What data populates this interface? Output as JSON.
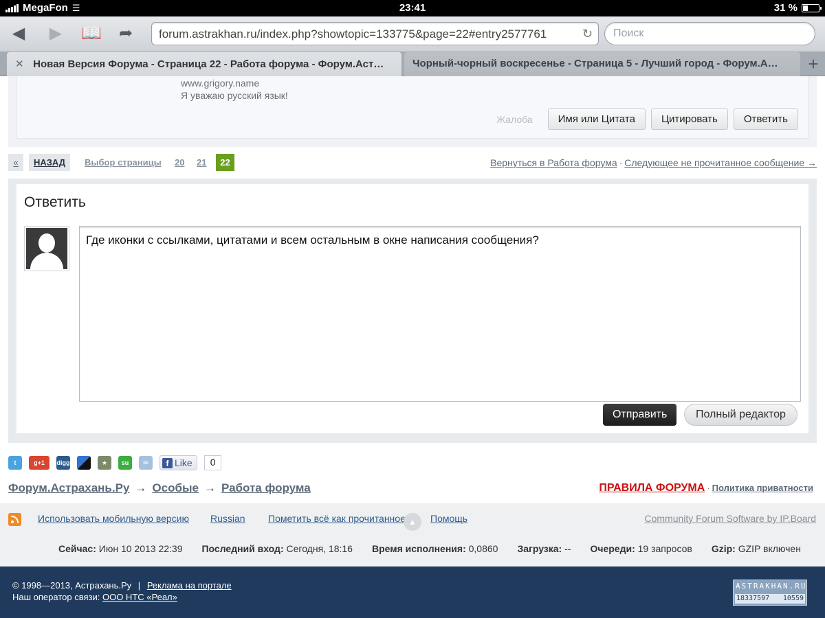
{
  "status_bar": {
    "carrier": "MegaFon",
    "time": "23:41",
    "battery": "31 %"
  },
  "browser": {
    "url": "forum.astrakhan.ru/index.php?showtopic=133775&page=22#entry2577761",
    "search_placeholder": "Поиск",
    "tabs": [
      {
        "title": "Новая Версия Форума - Страница 22 - Работа форума - Форум.Аст…",
        "active": true
      },
      {
        "title": "Чорный-чорный воскресенье - Страница 5 - Лучший город - Форум.А…",
        "active": false
      }
    ]
  },
  "post": {
    "signature_line1": "www.grigory.name",
    "signature_line2": "Я уважаю русский язык!",
    "complain_label": "Жалоба",
    "name_quote_label": "Имя или Цитата",
    "quote_label": "Цитировать",
    "reply_label": "Ответить"
  },
  "pagination": {
    "prev": "«",
    "back": "НАЗАД",
    "choose": "Выбор страницы",
    "pages": [
      "20",
      "21",
      "22"
    ],
    "current": "22",
    "return_link": "Вернуться в Работа форума",
    "next_unread": "Следующее не прочитанное сообщение →"
  },
  "reply": {
    "title": "Ответить",
    "text": "Где иконки с ссылками, цитатами и всем остальным в окне написания сообщения?",
    "submit_label": "Отправить",
    "full_editor_label": "Полный редактор"
  },
  "share": {
    "like_label": "Like",
    "like_count": "0"
  },
  "breadcrumbs": [
    "Форум.Астрахань.Ру",
    "Особые",
    "Работа форума"
  ],
  "rules": {
    "rules_label": "ПРАВИЛА ФОРУМА",
    "privacy_label": "Политика приватности"
  },
  "footer": {
    "mobile": "Использовать мобильную версию",
    "language": "Russian",
    "mark_read": "Пометить всё как прочитанное",
    "help": "Помощь",
    "powered": "Community Forum Software by IP.Board",
    "stats": {
      "now_label": "Сейчас:",
      "now_value": "Июн 10 2013 22:39",
      "last_label": "Последний вход:",
      "last_value": "Сегодня, 18:16",
      "exec_label": "Время исполнения:",
      "exec_value": "0,0860",
      "load_label": "Загрузка:",
      "load_value": "--",
      "queue_label": "Очереди:",
      "queue_value": "19 запросов",
      "gzip_label": "Gzip:",
      "gzip_value": "GZIP включен"
    }
  },
  "bottom": {
    "copyright": "© 1998—2013, Астрахань.Ру",
    "separator": "|",
    "ads": "Реклама на портале",
    "operator_label": "Наш оператор связи:",
    "operator_link": "ООО НТС «Реал»",
    "counter_title": "ASTRAKHAN.RU",
    "counter_a": "18337597",
    "counter_b": "10559"
  },
  "colors": {
    "accent_green": "#6a9f1e",
    "footer_blue": "#1f3a5c",
    "rules_red": "#cc1111"
  }
}
